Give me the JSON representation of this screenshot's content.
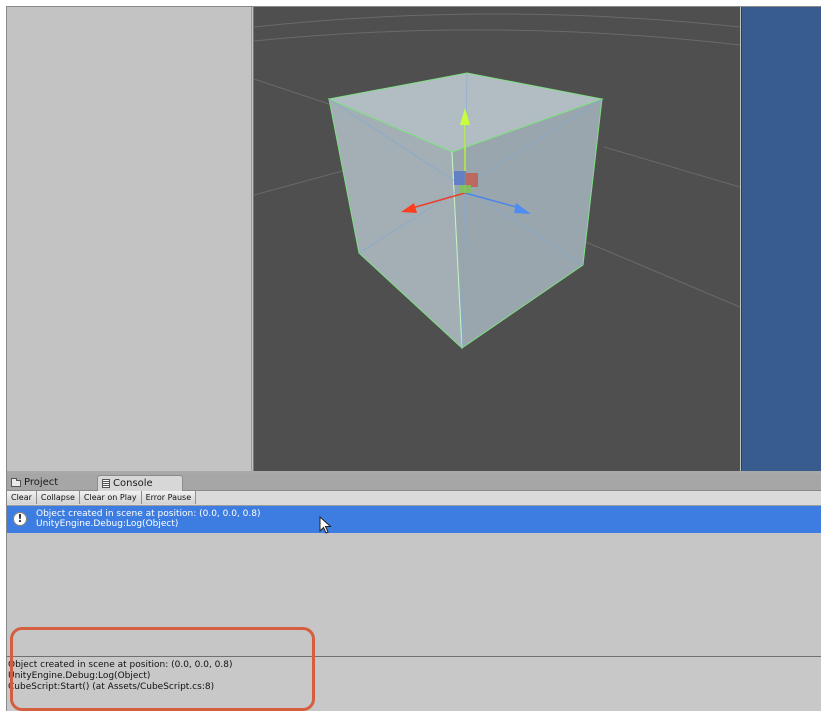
{
  "tabs": {
    "project": {
      "label": "Project",
      "icon": "folder-icon"
    },
    "console": {
      "label": "Console",
      "icon": "console-icon"
    }
  },
  "toolbar": {
    "clear": "Clear",
    "collapse": "Collapse",
    "clear_on_play": "Clear on Play",
    "error_pause": "Error Pause"
  },
  "console_log": {
    "selected_entry": {
      "icon": "info-icon",
      "icon_glyph": "!",
      "message": "Object created in scene at position: (0.0, 0.0, 0.8)",
      "source": "UnityEngine.Debug:Log(Object)"
    }
  },
  "detail": {
    "line1": "Object created in scene at position: (0.0, 0.0, 0.8)",
    "line2": "UnityEngine.Debug:Log(Object)",
    "line3": "CubeScript:Start() (at Assets/CubeScript.cs:8)"
  },
  "colors": {
    "scene_bg": "#4f4f4f",
    "game_bg": "#395c8e",
    "selection": "#3d7de2",
    "annotation": "#d45e3e",
    "gizmo_x": "#e8402a",
    "gizmo_y": "#b8ef3a",
    "gizmo_z": "#4a86e8"
  }
}
